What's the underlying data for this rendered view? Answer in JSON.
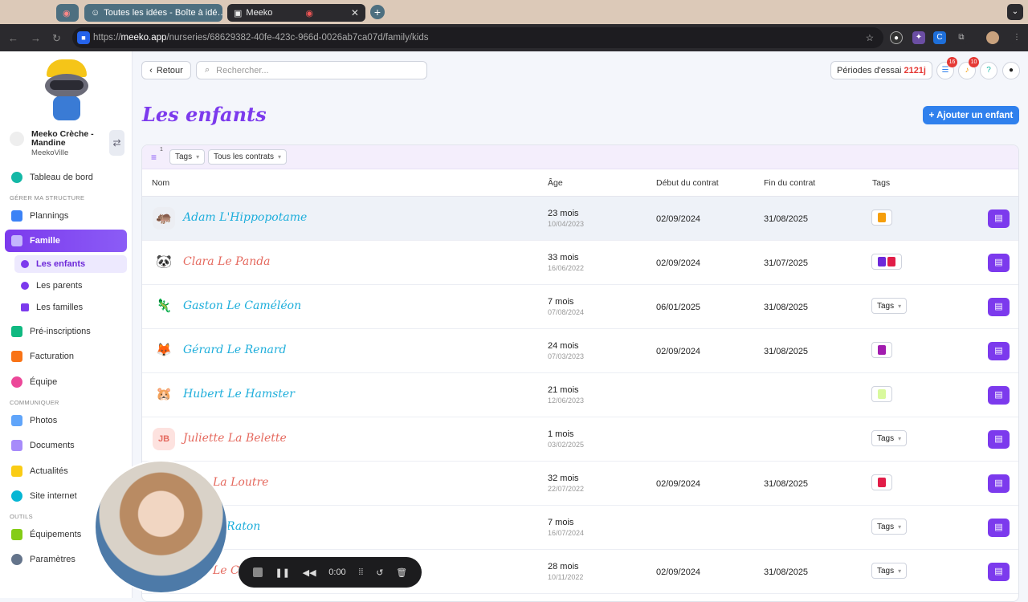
{
  "browser": {
    "tabs": [
      {
        "label": "Toutes les idées - Boîte à idé…"
      },
      {
        "label": "Meeko"
      }
    ],
    "url_host": "meeko.app",
    "url_prefix": "https://",
    "url_path": "/nurseries/68629382-40fe-423c-966d-0026ab7ca07d/family/kids"
  },
  "sidebar": {
    "nursery_name": "Meeko Crèche - Mandine",
    "nursery_city": "MeekoVille",
    "dashboard": "Tableau de bord",
    "section_manage": "GÉRER MA STRUCTURE",
    "plannings": "Plannings",
    "famille": "Famille",
    "sub": [
      "Les enfants",
      "Les parents",
      "Les familles"
    ],
    "preinscriptions": "Pré-inscriptions",
    "facturation": "Facturation",
    "equipe": "Équipe",
    "section_comm": "COMMUNIQUER",
    "photos": "Photos",
    "documents": "Documents",
    "actualites": "Actualités",
    "site": "Site internet",
    "section_tools": "OUTILS",
    "equipements": "Équipements",
    "parametres": "Paramètres"
  },
  "header": {
    "back": "Retour",
    "search_placeholder": "Rechercher...",
    "trial_label": "Périodes d'essai",
    "trial_value": "2121j",
    "badge_tasks": "16",
    "badge_notif": "10"
  },
  "page": {
    "title": "Les enfants",
    "add_button": "+ Ajouter un enfant",
    "filter_count": "1",
    "filter_tags": "Tags",
    "filter_contracts": "Tous les contrats"
  },
  "table": {
    "columns": [
      "Nom",
      "Âge",
      "Début du contrat",
      "Fin du contrat",
      "Tags"
    ],
    "rows": [
      {
        "name": "Adam L'Hippopotame",
        "age": "23 mois",
        "birth": "10/04/2023",
        "start": "02/09/2024",
        "end": "31/08/2025",
        "tags": ""
      },
      {
        "name": "Clara Le Panda",
        "age": "33 mois",
        "birth": "16/06/2022",
        "start": "02/09/2024",
        "end": "31/07/2025",
        "tags": ""
      },
      {
        "name": "Gaston Le Caméléon",
        "age": "7 mois",
        "birth": "07/08/2024",
        "start": "06/01/2025",
        "end": "31/08/2025",
        "tags": "Tags"
      },
      {
        "name": "Gérard Le Renard",
        "age": "24 mois",
        "birth": "07/03/2023",
        "start": "02/09/2024",
        "end": "31/08/2025",
        "tags": ""
      },
      {
        "name": "Hubert Le Hamster",
        "age": "21 mois",
        "birth": "12/06/2023",
        "start": "",
        "end": "",
        "tags": ""
      },
      {
        "name": "Juliette La Belette",
        "initials": "JB",
        "age": "1 mois",
        "birth": "03/02/2025",
        "start": "",
        "end": "",
        "tags": "Tags"
      },
      {
        "name": "La Loutre",
        "age": "32 mois",
        "birth": "22/07/2022",
        "start": "02/09/2024",
        "end": "31/08/2025",
        "tags": ""
      },
      {
        "name": "Raton",
        "age": "7 mois",
        "birth": "16/07/2024",
        "start": "",
        "end": "",
        "tags": "Tags"
      },
      {
        "name": "Le C",
        "age": "28 mois",
        "birth": "10/11/2022",
        "start": "02/09/2024",
        "end": "31/08/2025",
        "tags": "Tags"
      }
    ]
  },
  "recorder": {
    "time": "0:00"
  }
}
